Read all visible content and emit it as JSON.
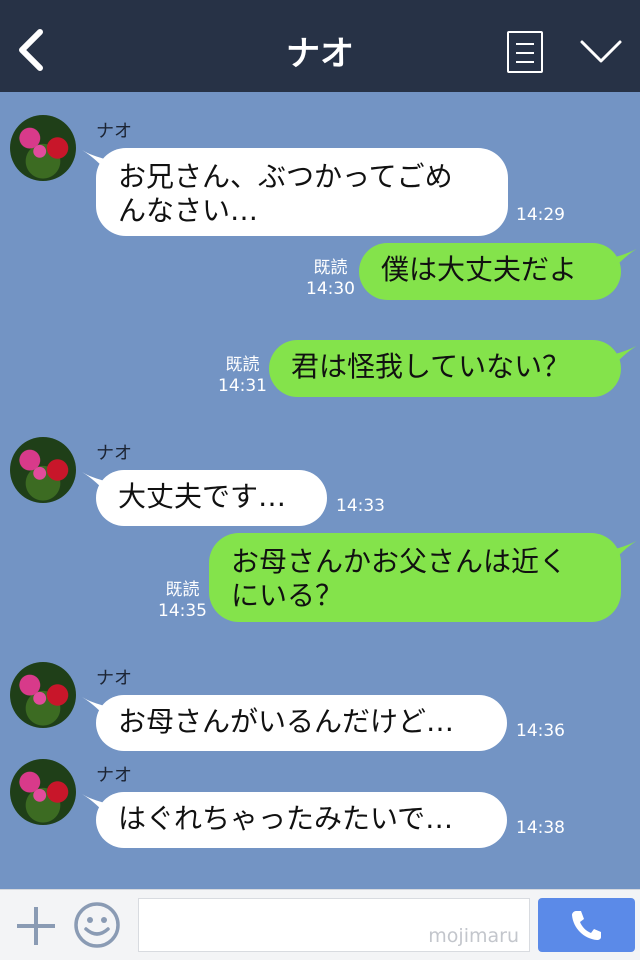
{
  "header": {
    "title": "ナオ"
  },
  "messages": [
    {
      "dir": "in",
      "sender": "ナオ",
      "text": "お兄さん、ぶつかってごめ\nんなさい…",
      "time": "14:29"
    },
    {
      "dir": "out",
      "read": "既読",
      "text": "僕は大丈夫だよ",
      "time": "14:30"
    },
    {
      "dir": "out",
      "read": "既読",
      "text": "君は怪我していない？",
      "time": "14:31"
    },
    {
      "dir": "in",
      "sender": "ナオ",
      "text": "大丈夫です…",
      "time": "14:33"
    },
    {
      "dir": "out",
      "read": "既読",
      "text": "お母さんかお父さんは近く\nにいる？",
      "time": "14:35"
    },
    {
      "dir": "in",
      "sender": "ナオ",
      "text": "お母さんがいるんだけど…",
      "time": "14:36"
    },
    {
      "dir": "in",
      "sender": "ナオ",
      "text": "はぐれちゃったみたいで…",
      "time": "14:38"
    }
  ],
  "footer": {
    "watermark": "mojimaru"
  },
  "icons": {
    "back": "chevron-left-icon",
    "menu": "menu-icon",
    "collapse": "chevron-down-icon",
    "plus": "plus-icon",
    "emoji": "smile-icon",
    "call": "phone-icon"
  },
  "colors": {
    "header": "#273246",
    "background": "#7394c4",
    "outgoing": "#84e34b",
    "incoming": "#ffffff",
    "call_button": "#5b8ae8"
  }
}
